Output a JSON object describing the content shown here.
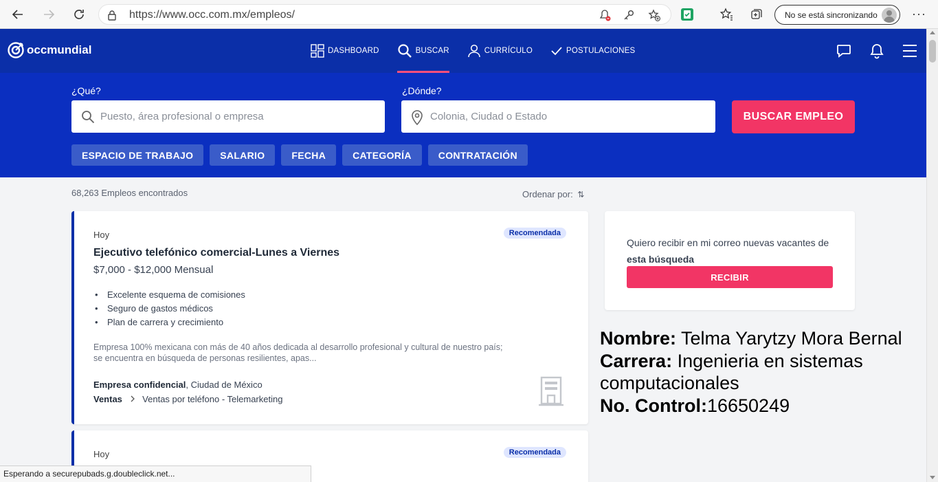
{
  "browser": {
    "url": "https://www.occ.com.mx/empleos/",
    "sync_label": "No se está sincronizando",
    "more_label": "···"
  },
  "site": {
    "logo_text": "occmundial",
    "menu": [
      {
        "label": "DASHBOARD"
      },
      {
        "label": "BUSCAR"
      },
      {
        "label": "CURRÍCULO"
      },
      {
        "label": "POSTULACIONES"
      }
    ]
  },
  "search": {
    "what_label": "¿Qué?",
    "what_placeholder": "Puesto, área profesional o empresa",
    "where_label": "¿Dónde?",
    "where_placeholder": "Colonia, Ciudad o Estado",
    "button": "BUSCAR EMPLEO",
    "filters": [
      "ESPACIO DE TRABAJO",
      "SALARIO",
      "FECHA",
      "CATEGORÍA",
      "CONTRATACIÓN"
    ]
  },
  "results": {
    "count": "68,263 Empleos encontrados",
    "order_label": "Ordenar por:",
    "order_icon": "⇅"
  },
  "job1": {
    "when": "Hoy",
    "badge": "Recomendada",
    "title": "Ejecutivo telefónico comercial-Lunes a Viernes",
    "salary": "$7,000 - $12,000 Mensual",
    "benefits": [
      "Excelente esquema de comisiones",
      "Seguro de gastos médicos",
      "Plan de carrera y crecimiento"
    ],
    "description": "Empresa 100% mexicana con más de 40 años dedicada al desarrollo profesional y cultural de nuestro país; se encuentra en búsqueda de personas resilientes, apas...",
    "company": "Empresa confidencial",
    "location": ", Ciudad de México",
    "category": "Ventas",
    "subcategory": "Ventas por teléfono - Telemarketing"
  },
  "job2": {
    "when": "Hoy",
    "badge": "Recomendada"
  },
  "alert": {
    "text_prefix": "Quiero recibir en mi correo nuevas vacantes de ",
    "text_bold": "esta búsqueda",
    "button": "RECIBIR"
  },
  "student": {
    "name_label": "Nombre:",
    "name": " Telma Yarytzy Mora Bernal",
    "career_label": "Carrera:",
    "career": " Ingenieria en sistemas computacionales",
    "control_label": "No. Control:",
    "control": "16650249"
  },
  "status_bar": "Esperando a securepubads.g.doubleclick.net..."
}
